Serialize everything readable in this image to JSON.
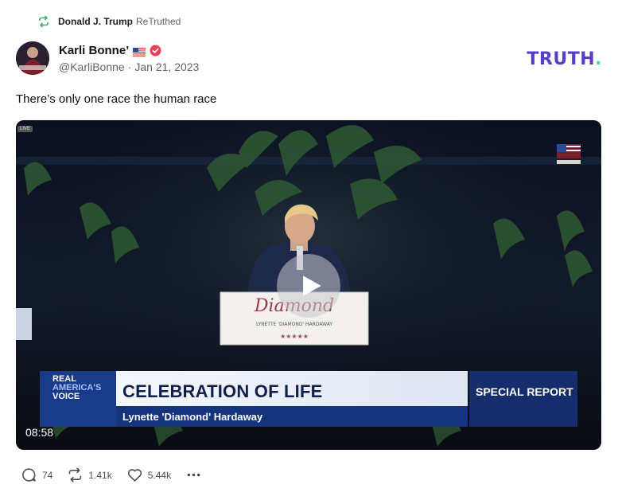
{
  "retruth": {
    "user": "Donald J. Trump",
    "label": "ReTruthed"
  },
  "author": {
    "name": "Karli Bonne’",
    "handle": "@KarliBonne",
    "date": "Jan 21, 2023",
    "separator": "·"
  },
  "logo": {
    "text": "TRUTH",
    "dot": "."
  },
  "post": {
    "text": "There’s only one race the human race"
  },
  "video": {
    "duration": "08:58",
    "live_tag": "LIVE",
    "lower_third": {
      "brand_line1": "REAL",
      "brand_line2": "AMERICA'S",
      "brand_line3": "VOICE",
      "headline": "CELEBRATION OF LIFE",
      "subline": "Lynette 'Diamond' Hardaway",
      "special": "SPECIAL REPORT"
    },
    "podium_script": "Diamond",
    "podium_small": "LYNETTE 'DIAMOND' HARDAWAY"
  },
  "actions": {
    "replies": "74",
    "retruths": "1.41k",
    "likes": "5.44k"
  },
  "colors": {
    "accent": "#5440c8",
    "logo_dot": "#3be0b0",
    "retruth_green": "#3fae6a",
    "verified_red": "#e8455a"
  }
}
